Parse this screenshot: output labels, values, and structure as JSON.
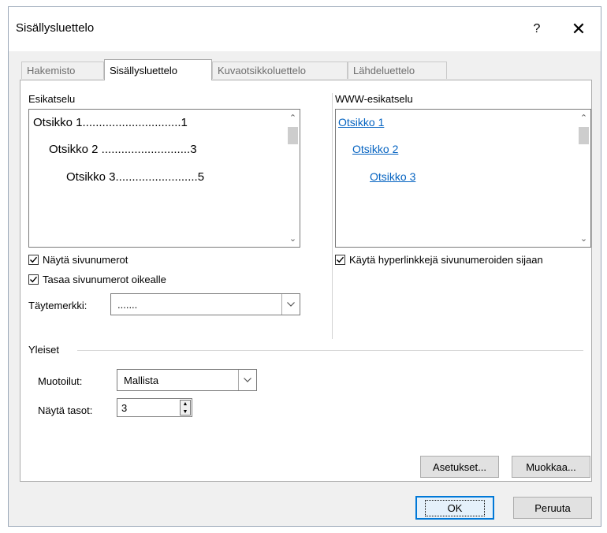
{
  "window": {
    "title": "Sisällysluettelo",
    "help_glyph": "?",
    "close_glyph": "✕"
  },
  "tabs": [
    {
      "label": "Hakemisto",
      "active": false
    },
    {
      "label": "Sisällysluettelo",
      "active": true
    },
    {
      "label": "Kuvaotsikkoluettelo",
      "active": false
    },
    {
      "label": "Lähdeluettelo",
      "active": false
    }
  ],
  "print_preview": {
    "label": "Esikatselu",
    "lines": [
      "Otsikko 1..............................1",
      "Otsikko 2 ...........................3",
      "Otsikko 3.........................5"
    ]
  },
  "web_preview": {
    "label": "WWW-esikatselu",
    "links": [
      "Otsikko 1",
      "Otsikko 2",
      "Otsikko 3"
    ]
  },
  "options": {
    "show_page_numbers": {
      "label": "Näytä sivunumerot",
      "checked": true
    },
    "right_align": {
      "label": "Tasaa sivunumerot oikealle",
      "checked": true
    },
    "use_hyperlinks": {
      "label": "Käytä hyperlinkkejä sivunumeroiden sijaan",
      "checked": true
    },
    "tab_leader": {
      "label": "Täytemerkki:",
      "value": "......."
    }
  },
  "general": {
    "heading": "Yleiset",
    "formats": {
      "label": "Muotoilut:",
      "value": "Mallista"
    },
    "show_levels": {
      "label": "Näytä tasot:",
      "value": "3"
    }
  },
  "buttons": {
    "options": "Asetukset...",
    "modify": "Muokkaa...",
    "ok": "OK",
    "cancel": "Peruuta"
  },
  "colors": {
    "link": "#0563c1",
    "default_button_border": "#0078d7"
  }
}
